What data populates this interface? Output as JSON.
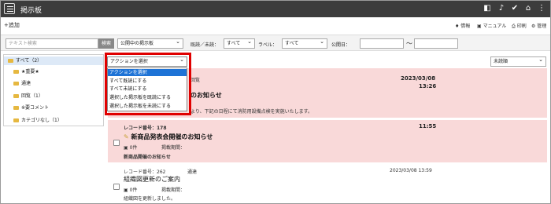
{
  "app": {
    "title": "掲示板"
  },
  "toolbar": {
    "add": "+追加",
    "links": [
      "情報",
      "マニュアル",
      "印刷",
      "管理"
    ]
  },
  "filter": {
    "search_placeholder": "テキスト検索",
    "search_button": "検索",
    "board_select": "公開中の掲示板",
    "read_label": "既読／未読：",
    "read_value": "すべて",
    "label_label": "ラベル：",
    "label_value": "すべて",
    "date_label": "公開日：",
    "tilde": "～"
  },
  "sidebar": {
    "items": [
      {
        "label": "すべて（2）"
      },
      {
        "label": "★重要★"
      },
      {
        "label": "通達"
      },
      {
        "label": "回覧（1）"
      },
      {
        "label": "※要コメント"
      },
      {
        "label": "カテゴリなし（1）"
      }
    ]
  },
  "action_dropdown": {
    "value": "アクションを選択",
    "options": [
      "アクションを選択",
      "すべて既読にする",
      "すべて未読にする",
      "選択した掲示板を既読にする",
      "選択した掲示板を未読にする"
    ]
  },
  "sort_select": {
    "value": "未読順"
  },
  "records": [
    {
      "category": "回覧",
      "date": "2023/03/08",
      "time": "13:26",
      "title": "のお知らせ",
      "body": "より、下記の日程にて消防用設備点検を実施いたします。"
    },
    {
      "record_no": "レコード番号：178",
      "time": "11:55",
      "title": "新商品発表会開催のお知らせ",
      "comments": "0件",
      "period": "掲載期間：",
      "body": "新商品開催のお知らせ"
    },
    {
      "record_no": "レコード番号：262",
      "category": "通達",
      "date": "2023/03/08 13:59",
      "title": "組織図更新のご案内",
      "comments": "0件",
      "period": "掲載期間：",
      "body": "組織図を更新しました。"
    }
  ]
}
